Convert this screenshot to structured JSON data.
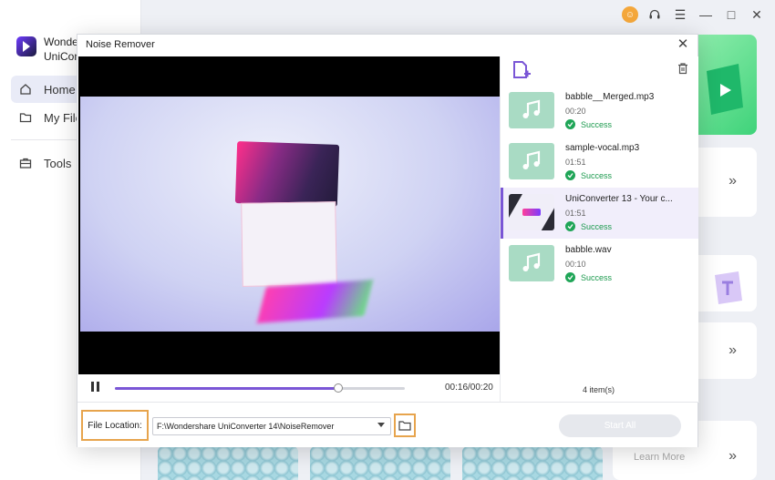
{
  "app": {
    "name": "Wondershare UniConverter",
    "name_line1": "Wonder",
    "name_line2": "UniConv"
  },
  "sidebar": {
    "items": [
      {
        "label": "Home",
        "icon": "home-icon",
        "active": true
      },
      {
        "label": "My File",
        "icon": "folder-icon",
        "active": false
      },
      {
        "label": "Tools",
        "icon": "toolbox-icon",
        "active": false
      }
    ]
  },
  "window_controls": {
    "icons": [
      "user-avatar",
      "headset-icon",
      "menu-icon",
      "minimize-icon",
      "maximize-icon",
      "close-icon"
    ]
  },
  "background": {
    "learn_more": "Learn More"
  },
  "dialog": {
    "title": "Noise Remover",
    "player": {
      "time": "00:16/00:20",
      "progress": 0.77
    },
    "files": [
      {
        "name": "babble__Merged.mp3",
        "duration": "00:20",
        "status": "Success",
        "type": "audio",
        "selected": false
      },
      {
        "name": "sample-vocal.mp3",
        "duration": "01:51",
        "status": "Success",
        "type": "audio",
        "selected": false
      },
      {
        "name": "UniConverter 13 - Your c...",
        "duration": "01:51",
        "status": "Success",
        "type": "video",
        "selected": true
      },
      {
        "name": "babble.wav",
        "duration": "00:10",
        "status": "Success",
        "type": "audio",
        "selected": false
      }
    ],
    "items_count": "4 item(s)",
    "footer": {
      "file_location_label": "File Location:",
      "file_location_path": "F:\\Wondershare UniConverter 14\\NoiseRemover",
      "start_all": "Start All"
    }
  },
  "colors": {
    "accent": "#7a56d6",
    "success": "#1fa557",
    "highlight_border": "#e7a44d"
  }
}
